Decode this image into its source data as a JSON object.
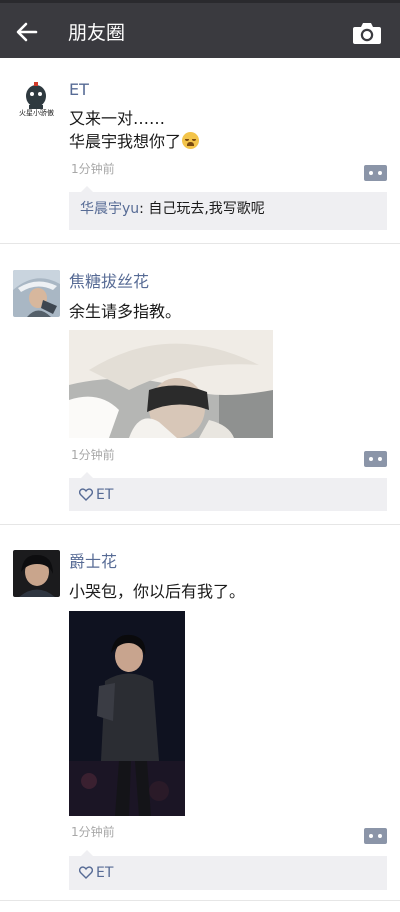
{
  "header": {
    "title": "朋友圈"
  },
  "posts": [
    {
      "name": "ET",
      "avatar_caption": "火星小骄傲",
      "lines": [
        "又来一对……",
        "华晨宇我想你了"
      ],
      "emoji": "crying-face-emoji",
      "time": "1分钟前",
      "comment": {
        "name": "华晨宇yu",
        "separator": ": ",
        "text": "自己玩去,我写歌呢"
      }
    },
    {
      "name": "焦糖拔丝花",
      "lines": [
        "余生请多指教。"
      ],
      "time": "1分钟前",
      "like": "ET"
    },
    {
      "name": "爵士花",
      "lines": [
        "小哭包，你以后有我了。"
      ],
      "time": "1分钟前",
      "like": "ET"
    }
  ],
  "colors": {
    "header_bg": "#3a3a3f",
    "name": "#576b95",
    "time": "#a8a8a8",
    "box_bg": "#efeff2"
  }
}
